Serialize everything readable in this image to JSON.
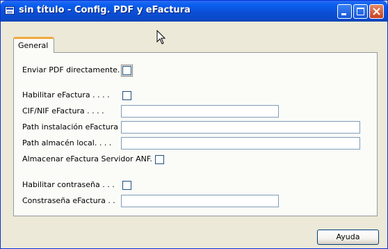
{
  "window": {
    "title": "sin título - Config. PDF y eFactura",
    "controls": {
      "minimize_icon": "minimize-icon",
      "maximize_icon": "maximize-icon",
      "close_icon": "close-icon"
    }
  },
  "tabs": [
    {
      "label": "General",
      "selected": true
    }
  ],
  "form": {
    "enviar_pdf": {
      "label": "Enviar PDF directamente.",
      "checked": false
    },
    "habilitar_efactura": {
      "label": "Habilitar eFactura . . . .",
      "checked": false
    },
    "cif_nif": {
      "label": "CIF/NIF eFactura . . . .",
      "value": ""
    },
    "path_instalacion": {
      "label": "Path instalación eFactura",
      "value": ""
    },
    "path_almacen": {
      "label": "Path almacén local. . . .",
      "value": ""
    },
    "almacenar_servidor": {
      "label": "Almacenar eFactura Servidor ANF.",
      "checked": false
    },
    "habilitar_contrasena": {
      "label": "Habilitar contraseña . . .",
      "checked": false
    },
    "contrasena": {
      "label": "Constraseña eFactura . .",
      "value": ""
    }
  },
  "buttons": {
    "help": "Ayuda"
  }
}
